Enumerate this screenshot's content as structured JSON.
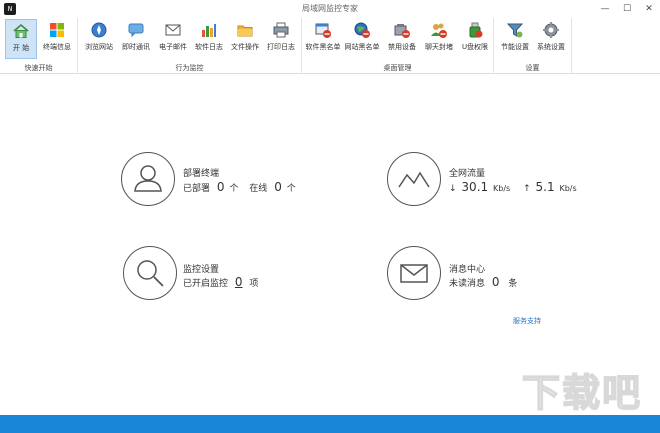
{
  "window": {
    "title": "局域网监控专家",
    "app_icon": "N",
    "minimize": "—",
    "maximize": "☐",
    "close": "✕"
  },
  "ribbon": {
    "groups": [
      {
        "label": "快速开始",
        "items": [
          "开 始",
          "终端信息"
        ]
      },
      {
        "label": "行为监控",
        "items": [
          "浏览网站",
          "即时通讯",
          "电子邮件",
          "软件日志",
          "文件操作",
          "打印日志"
        ]
      },
      {
        "label": "桌面管理",
        "items": [
          "软件黑名单",
          "网站黑名单",
          "禁用设备",
          "聊天封堵",
          "U盘权限"
        ]
      },
      {
        "label": "设置",
        "items": [
          "节能设置",
          "系统设置"
        ]
      }
    ]
  },
  "dashboard": {
    "deploy": {
      "title": "部署终端",
      "deployed_label": "已部署",
      "deployed": "0",
      "unit1": "个",
      "online_label": "在线",
      "online": "0",
      "unit2": "个"
    },
    "traffic": {
      "title": "全网流量",
      "down_arrow": "↓",
      "down": "30.1",
      "down_unit": "Kb/s",
      "up_arrow": "↑",
      "up": "5.1",
      "up_unit": "Kb/s"
    },
    "monitor": {
      "title": "监控设置",
      "enabled_label": "已开启监控",
      "enabled": "0",
      "unit": "项"
    },
    "messages": {
      "title": "消息中心",
      "unread_label": "未读消息",
      "unread": "0",
      "unit": "条"
    }
  },
  "service_link": "服务支持",
  "watermark": "下载吧"
}
